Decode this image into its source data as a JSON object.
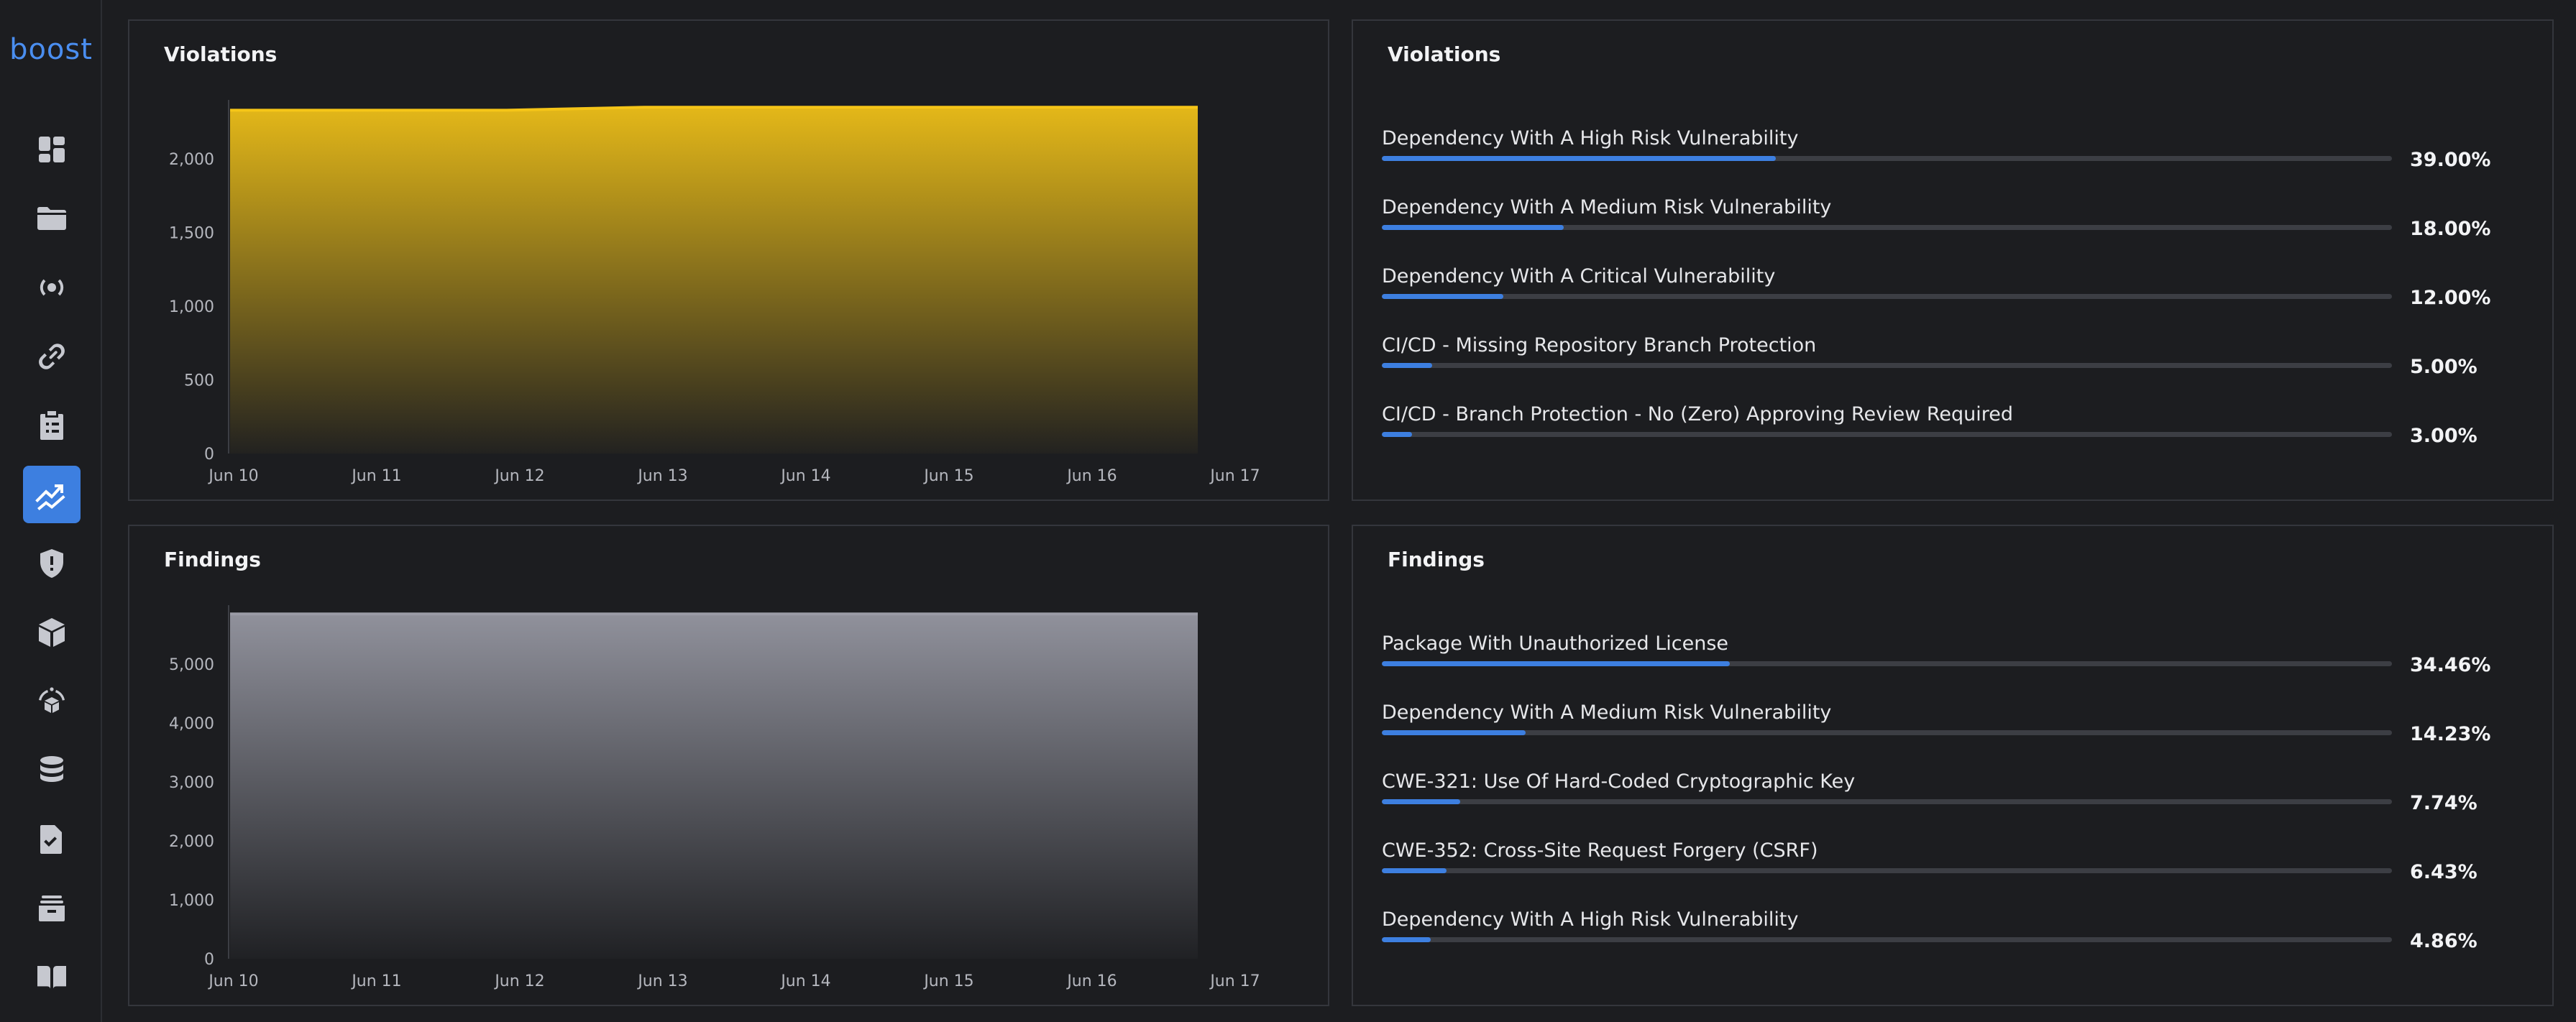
{
  "app": {
    "logo": "boost"
  },
  "sidebar": {
    "items": [
      {
        "name": "dashboard-icon",
        "active": false
      },
      {
        "name": "folder-icon",
        "active": false
      },
      {
        "name": "broadcast-icon",
        "active": false
      },
      {
        "name": "link-icon",
        "active": false
      },
      {
        "name": "clipboard-icon",
        "active": false
      },
      {
        "name": "trend-chart-icon",
        "active": true
      },
      {
        "name": "shield-alert-icon",
        "active": false
      },
      {
        "name": "package-icon",
        "active": false
      },
      {
        "name": "package-orbit-icon",
        "active": false
      },
      {
        "name": "database-icon",
        "active": false
      },
      {
        "name": "document-check-icon",
        "active": false
      },
      {
        "name": "archive-icon",
        "active": false
      },
      {
        "name": "book-icon",
        "active": false
      }
    ]
  },
  "violations_chart": {
    "title": "Violations",
    "chart_data": {
      "type": "area",
      "x": [
        "Jun 10",
        "Jun 11",
        "Jun 12",
        "Jun 13",
        "Jun 14",
        "Jun 15",
        "Jun 16",
        "Jun 17"
      ],
      "values": [
        2330,
        2330,
        2330,
        2350,
        2350,
        2350,
        2350,
        2350
      ],
      "yticks": [
        0,
        500,
        1000,
        1500,
        2000
      ],
      "ylim": [
        0,
        2400
      ],
      "color": "#f5c518"
    }
  },
  "findings_chart": {
    "title": "Findings",
    "chart_data": {
      "type": "area",
      "x": [
        "Jun 10",
        "Jun 11",
        "Jun 12",
        "Jun 13",
        "Jun 14",
        "Jun 15",
        "Jun 16",
        "Jun 17"
      ],
      "values": [
        5850,
        5850,
        5850,
        5850,
        5850,
        5850,
        5850,
        5850
      ],
      "yticks": [
        0,
        1000,
        2000,
        3000,
        4000,
        5000
      ],
      "ylim": [
        0,
        6000
      ],
      "color": "#9a9ba6"
    }
  },
  "violations_breakdown": {
    "title": "Violations",
    "items": [
      {
        "label": "Dependency With A High Risk Vulnerability",
        "value": "39.00%",
        "fraction": 0.39
      },
      {
        "label": "Dependency With A Medium Risk Vulnerability",
        "value": "18.00%",
        "fraction": 0.18
      },
      {
        "label": "Dependency With A Critical Vulnerability",
        "value": "12.00%",
        "fraction": 0.12
      },
      {
        "label": "CI/CD - Missing Repository Branch Protection",
        "value": "5.00%",
        "fraction": 0.05
      },
      {
        "label": "CI/CD - Branch Protection - No (Zero) Approving Review Required",
        "value": "3.00%",
        "fraction": 0.03
      }
    ]
  },
  "findings_breakdown": {
    "title": "Findings",
    "items": [
      {
        "label": "Package With Unauthorized License",
        "value": "34.46%",
        "fraction": 0.3446
      },
      {
        "label": "Dependency With A Medium Risk Vulnerability",
        "value": "14.23%",
        "fraction": 0.1423
      },
      {
        "label": "CWE-321: Use Of Hard-Coded Cryptographic Key",
        "value": "7.74%",
        "fraction": 0.0774
      },
      {
        "label": "CWE-352: Cross-Site Request Forgery (CSRF)",
        "value": "6.43%",
        "fraction": 0.0643
      },
      {
        "label": "Dependency With A High Risk Vulnerability",
        "value": "4.86%",
        "fraction": 0.0486
      }
    ]
  }
}
